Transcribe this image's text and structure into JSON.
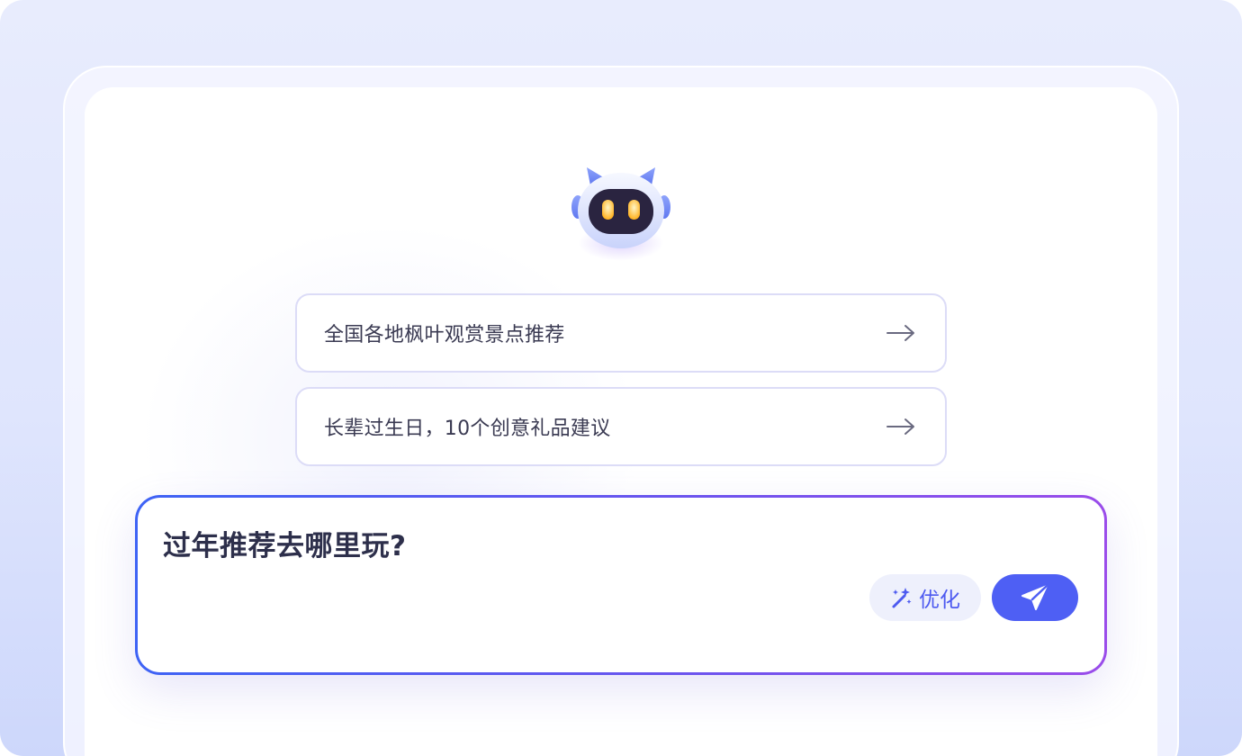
{
  "suggestions": [
    {
      "label": "全国各地枫叶观赏景点推荐",
      "icon": "arrow-right-icon"
    },
    {
      "label": "长辈过生日，10个创意礼品建议",
      "icon": "arrow-right-icon"
    }
  ],
  "input": {
    "value": "过年推荐去哪里玩?"
  },
  "actions": {
    "optimize_label": "优化",
    "optimize_icon": "magic-wand-icon",
    "send_icon": "send-icon"
  },
  "colors": {
    "accent": "#4e5ff4",
    "border_gradient_start": "#3e63f5",
    "border_gradient_end": "#9a4cea",
    "card_border": "#dcdcf7"
  }
}
